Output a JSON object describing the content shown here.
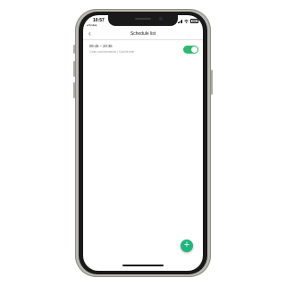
{
  "status_bar": {
    "time": "10:57",
    "carrier": "◂ Szukaj"
  },
  "nav": {
    "back_icon": "chevron-left-icon",
    "title": "Schedule list"
  },
  "schedules": [
    {
      "time_range": "06:45 – 20:35",
      "description": "Czas uruchomienia | Codziennie",
      "enabled": true
    }
  ],
  "fab": {
    "label": "+"
  },
  "colors": {
    "accent": "#1fb57f",
    "toggle_on": "#2fb86e"
  }
}
